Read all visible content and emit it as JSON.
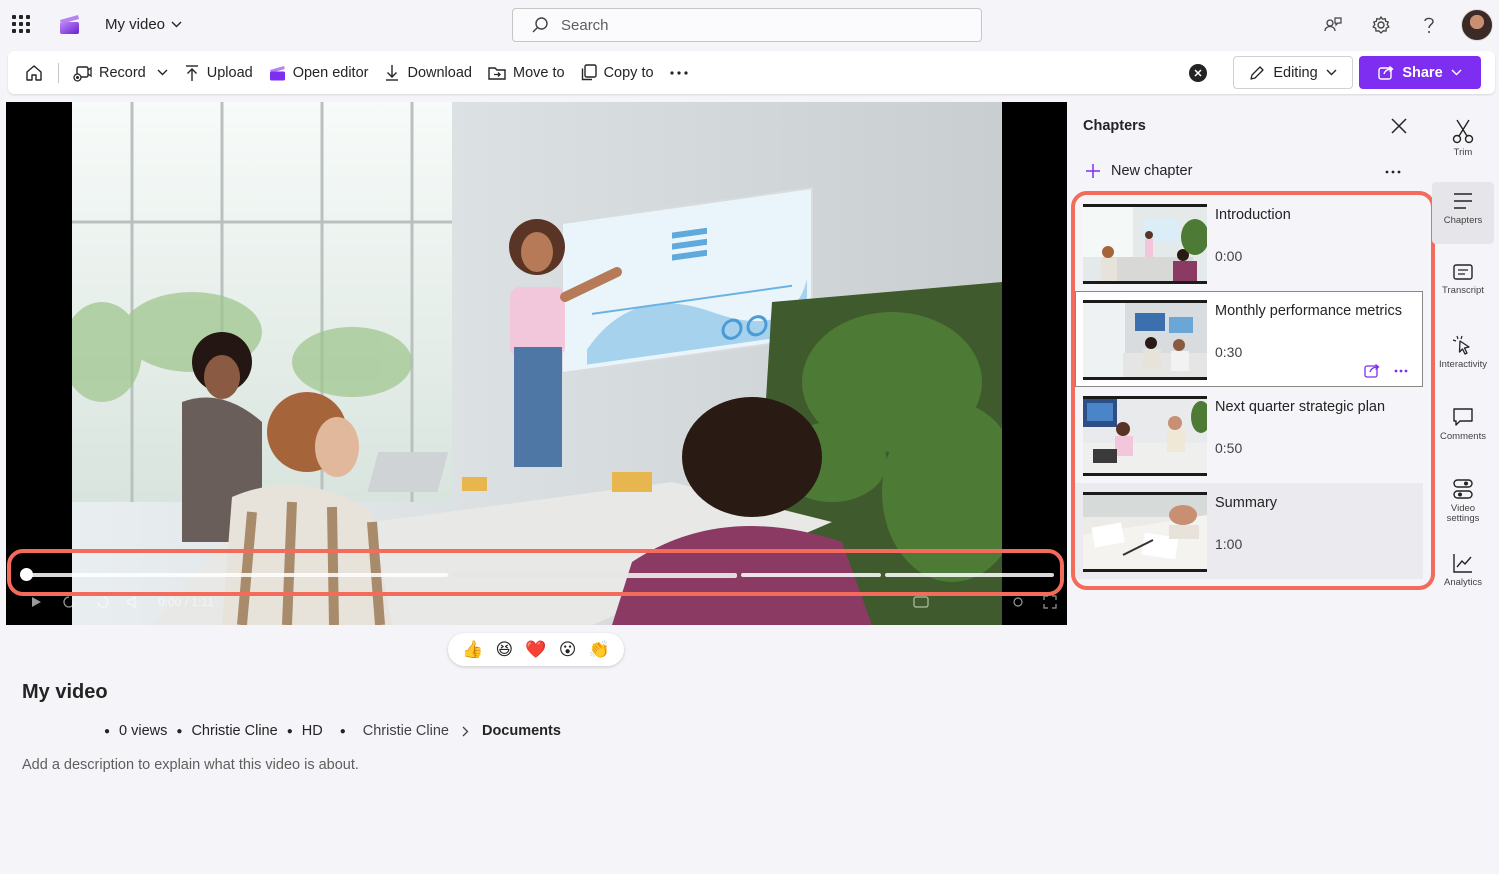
{
  "app": {
    "doc_title": "My video",
    "search_placeholder": "Search"
  },
  "toolbar": {
    "record": "Record",
    "upload": "Upload",
    "open_editor": "Open editor",
    "download": "Download",
    "move_to": "Move to",
    "copy_to": "Copy to",
    "editing": "Editing",
    "share": "Share"
  },
  "player": {
    "time_display": "0:00 / 1:11",
    "progress": 0
  },
  "video": {
    "title": "My video",
    "meta": {
      "views": "0 views",
      "owner": "Christie Cline",
      "quality": "HD",
      "location_parent": "Christie Cline",
      "location_folder": "Documents"
    },
    "description_placeholder": "Add a description to explain what this video is about."
  },
  "reactions": [
    "👍",
    "😆",
    "❤️",
    "😮",
    "👏"
  ],
  "chapters": {
    "title": "Chapters",
    "new_chapter": "New chapter",
    "items": [
      {
        "title": "Introduction",
        "time": "0:00"
      },
      {
        "title": "Monthly performance metrics",
        "time": "0:30"
      },
      {
        "title": "Next quarter strategic plan",
        "time": "0:50"
      },
      {
        "title": "Summary",
        "time": "1:00"
      }
    ]
  },
  "rail": {
    "trim": "Trim",
    "chapters": "Chapters",
    "transcript": "Transcript",
    "interactivity": "Interactivity",
    "comments": "Comments",
    "video_settings": "Video settings",
    "analytics": "Analytics"
  },
  "colors": {
    "accent": "#7e2ef0",
    "highlight": "#f26b5b"
  }
}
